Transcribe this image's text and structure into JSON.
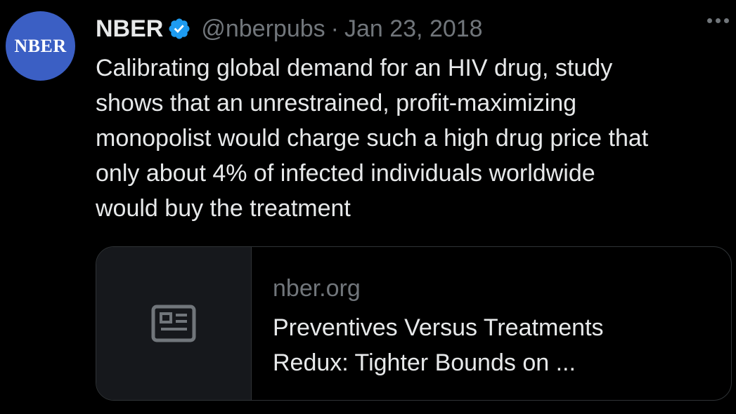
{
  "author": {
    "avatar_text": "NBER",
    "name": "NBER",
    "handle": "@nberpubs",
    "separator": "·",
    "date": "Jan 23, 2018"
  },
  "icons": {
    "verified": "verified-badge-icon",
    "more": "more-options-icon",
    "article": "article-icon"
  },
  "tweet": {
    "lines": [
      "Calibrating global demand for an HIV drug, study",
      "shows that an unrestrained, profit-maximizing",
      "monopolist would charge such a high drug price that",
      "only about 4% of infected individuals worldwide",
      "would buy the treatment"
    ]
  },
  "card": {
    "domain": "nber.org",
    "title_lines": [
      "Preventives Versus Treatments",
      "Redux: Tighter Bounds on ..."
    ]
  },
  "colors": {
    "background": "#000000",
    "text_primary": "#e7e9ea",
    "text_secondary": "#71767b",
    "verified_blue": "#1d9bf0",
    "avatar_blue": "#3b5fc4",
    "card_border": "#2f3336",
    "card_thumb_bg": "#16181c"
  }
}
